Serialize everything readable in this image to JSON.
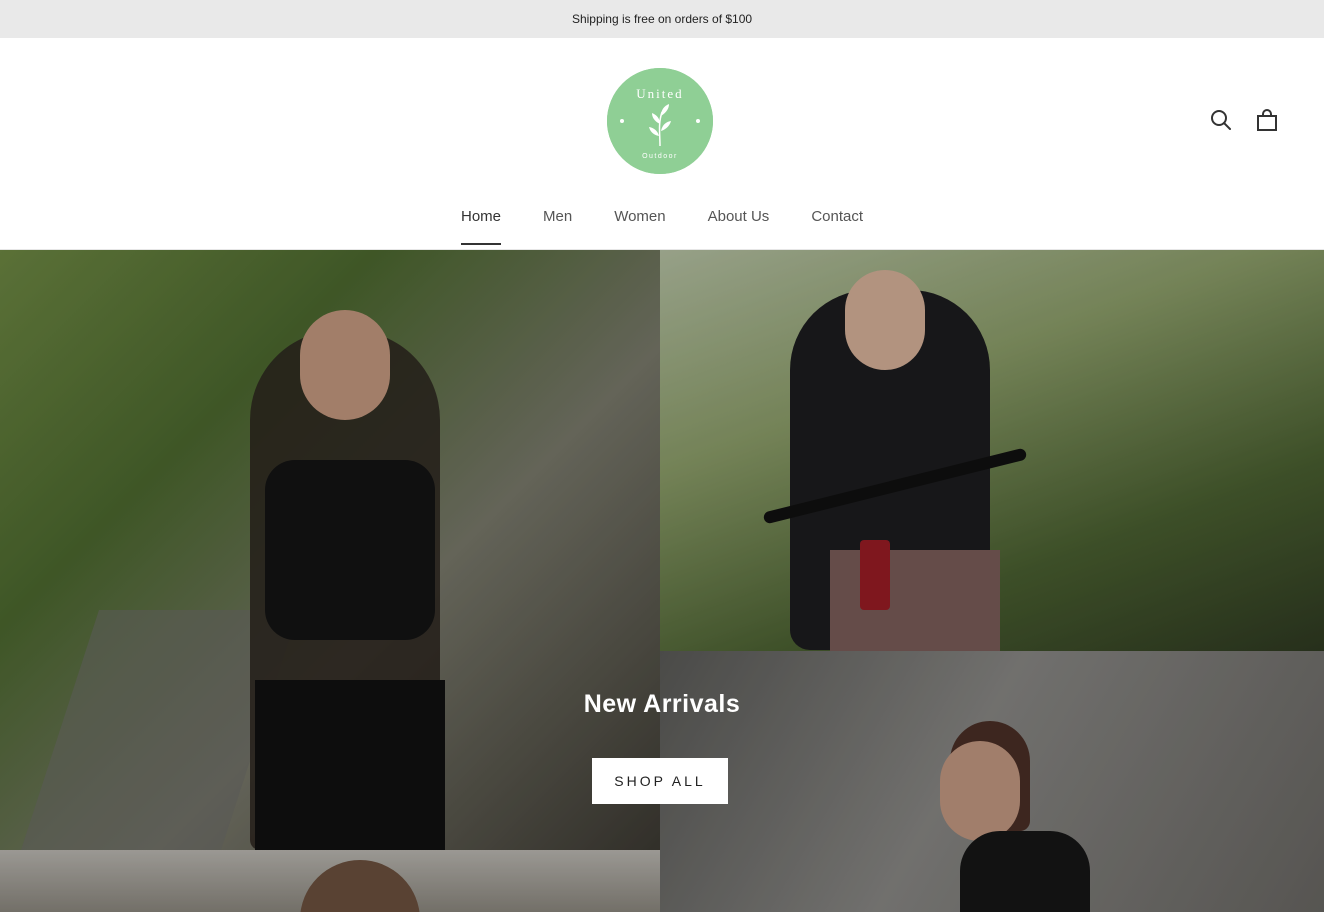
{
  "announcement": {
    "text": "Shipping is free on orders of $100"
  },
  "logo": {
    "name": "Logo"
  },
  "header": {
    "icons": [
      "search-icon",
      "cart-icon"
    ]
  },
  "nav": {
    "items": [
      {
        "label": "Home",
        "active": true
      },
      {
        "label": "Men",
        "active": false
      },
      {
        "label": "Women",
        "active": false
      },
      {
        "label": "About Us",
        "active": false
      },
      {
        "label": "Contact",
        "active": false
      }
    ]
  },
  "hero": {
    "title": "New Arrivals",
    "button_label": "SHOP ALL"
  },
  "colors": {
    "announcement_bg": "#e9e9e9",
    "logo_green": "#8fcf95",
    "button_bg": "#ffffff"
  }
}
